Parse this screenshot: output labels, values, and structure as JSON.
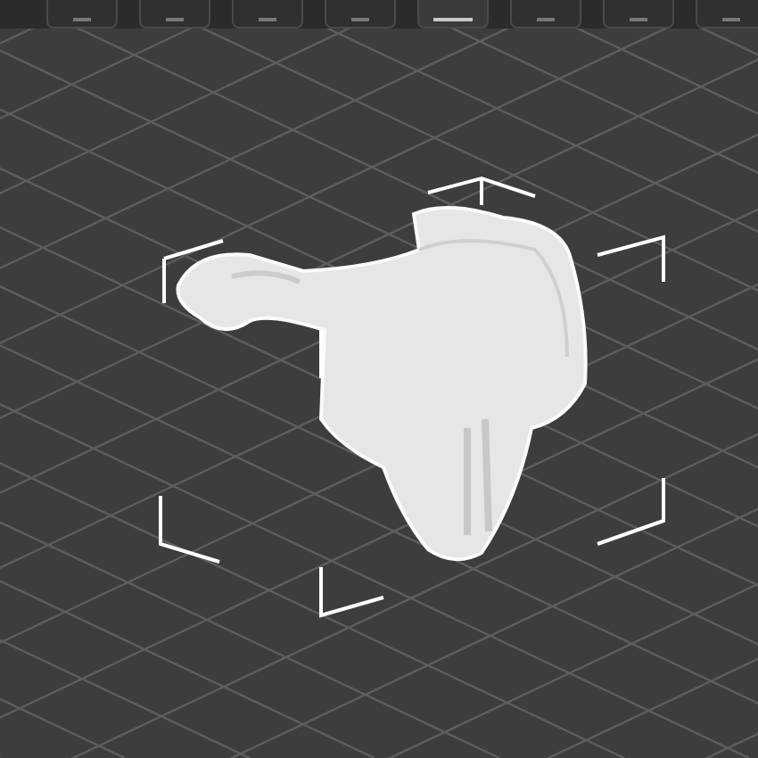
{
  "toolbar": {
    "buttons": [
      {
        "kind": "tool",
        "selected": false
      },
      {
        "kind": "tool",
        "selected": false
      },
      {
        "kind": "tool",
        "selected": false
      },
      {
        "kind": "tool",
        "selected": false
      },
      {
        "kind": "tool",
        "selected": true
      },
      {
        "kind": "tool",
        "selected": false
      },
      {
        "kind": "tool",
        "selected": false
      },
      {
        "kind": "tool",
        "selected": false
      }
    ]
  },
  "viewport": {
    "kind": "model",
    "selected": true
  }
}
